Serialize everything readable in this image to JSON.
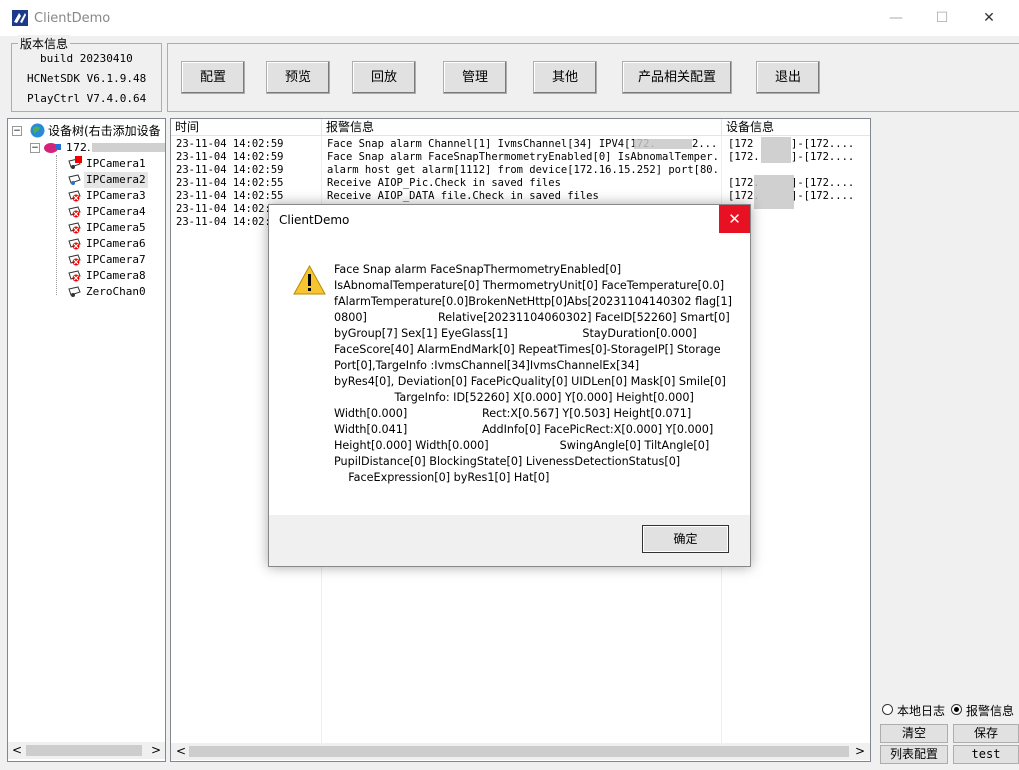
{
  "window": {
    "title": "ClientDemo",
    "minimize": "—",
    "maximize": "☐",
    "close": "✕"
  },
  "version": {
    "legend": "版本信息",
    "build": "build 20230410",
    "sdk": "HCNetSDK V6.1.9.48",
    "playctrl": "PlayCtrl V7.4.0.64"
  },
  "toolbar": [
    "配置",
    "预览",
    "回放",
    "管理",
    "其他",
    "产品相关配置",
    "退出"
  ],
  "tree": {
    "root_label": "设备树(右击添加设备",
    "device_label": "172.",
    "cameras": [
      "IPCamera1",
      "IPCamera2",
      "IPCamera3",
      "IPCamera4",
      "IPCamera5",
      "IPCamera6",
      "IPCamera7",
      "IPCamera8",
      "ZeroChan0"
    ],
    "scroll_left": "<",
    "scroll_right": ">"
  },
  "list": {
    "headers": [
      "时间",
      "报警信息",
      "设备信息"
    ],
    "rows": [
      {
        "time": "23-11-04 14:02:59",
        "info": "Face Snap alarm Channel[1] IvmsChannel[34] IPV4[172.",
        "dev": "[172",
        "dev2": "]-[172....",
        "info2": "2..."
      },
      {
        "time": "23-11-04 14:02:59",
        "info": "Face Snap alarm FaceSnapThermometryEnabled[0] IsAbnomalTemper...",
        "dev": "[172.",
        "dev2": "]-[172....",
        "info2": ""
      },
      {
        "time": "23-11-04 14:02:59",
        "info": "alarm host get alarm[1112] from device[172.16.15.252] port[80...",
        "dev": "",
        "dev2": "",
        "info2": ""
      },
      {
        "time": "23-11-04 14:02:55",
        "info": "Receive AIOP_Pic.Check in saved files",
        "dev": "[172.",
        "dev2": "]-[172....",
        "info2": ""
      },
      {
        "time": "23-11-04 14:02:55",
        "info": "Receive AIOP_DATA file.Check in saved files",
        "dev": "[172.",
        "dev2": "]-[172....",
        "info2": ""
      },
      {
        "time": "23-11-04 14:02:5",
        "info": "",
        "dev": "",
        "dev2": "",
        "info2": ""
      },
      {
        "time": "23-11-04 14:02:5",
        "info": "",
        "dev": "",
        "dev2": "",
        "info2": ""
      }
    ],
    "scroll_left": "<",
    "scroll_right": ">"
  },
  "right_panel": {
    "radio_local": "本地日志",
    "radio_alarm": "报警信息",
    "buttons": [
      "清空",
      "保存",
      "列表配置",
      "test"
    ]
  },
  "dialog": {
    "title": "ClientDemo",
    "close": "✕",
    "ok": "确定",
    "lines": [
      "Face Snap alarm FaceSnapThermometryEnabled[0]",
      "IsAbnomalTemperature[0] ThermometryUnit[0] FaceTemperature[0.0]",
      "fAlarmTemperature[0.0]BrokenNetHttp[0]Abs[20231104140302 flag[1]",
      "0800]                    Relative[20231104060302] FaceID[52260] Smart[0]",
      "byGroup[7] Sex[1] EyeGlass[1]                     StayDuration[0.000]",
      "FaceScore[40] AlarmEndMark[0] RepeatTimes[0]-StorageIP[] Storage",
      "Port[0],TargeInfo :IvmsChannel[34]IvmsChannelEx[34]",
      "byRes4[0], Deviation[0] FacePicQuality[0] UIDLen[0] Mask[0] Smile[0]",
      "                 TargeInfo: ID[52260] X[0.000] Y[0.000] Height[0.000]",
      "Width[0.000]                     Rect:X[0.567] Y[0.503] Height[0.071]",
      "Width[0.041]                     AddInfo[0] FacePicRect:X[0.000] Y[0.000]",
      "Height[0.000] Width[0.000]                    SwingAngle[0] TiltAngle[0]",
      "PupilDistance[0] BlockingState[0] LivenessDetectionStatus[0]",
      "    FaceExpression[0] byRes1[0] Hat[0]"
    ]
  }
}
